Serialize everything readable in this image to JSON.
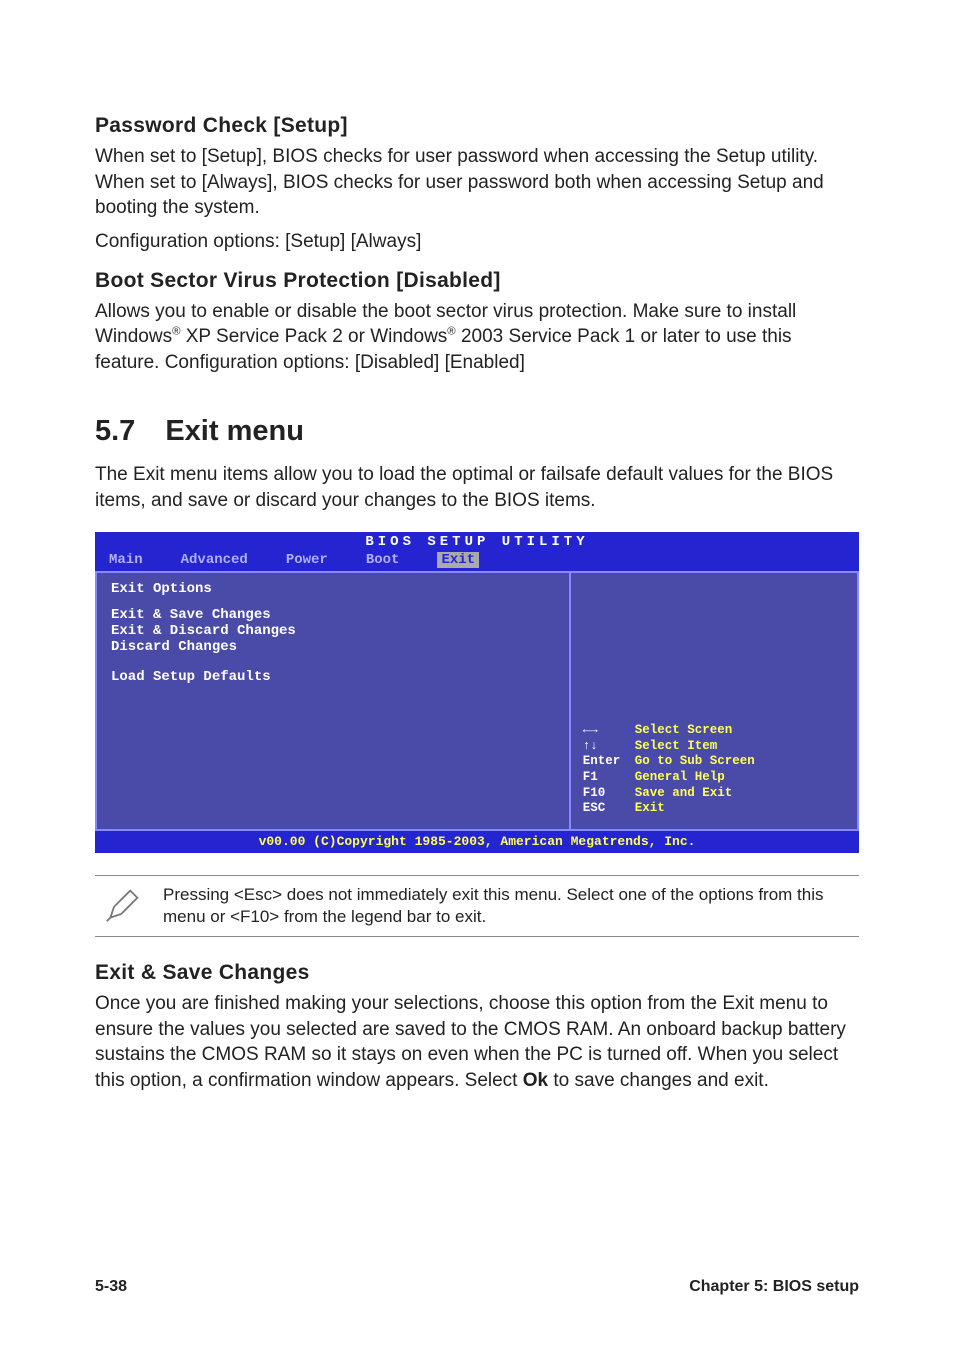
{
  "section1": {
    "heading": "Password Check [Setup]",
    "body": "When set to [Setup], BIOS checks for user password when accessing the Setup utility. When set to [Always], BIOS checks for user password both when accessing Setup and booting the system.",
    "opts": "Configuration options: [Setup] [Always]"
  },
  "section2": {
    "heading": "Boot Sector Virus Protection [Disabled]",
    "body_a": "Allows you to enable or disable the boot sector virus protection. Make sure to install Windows",
    "body_b": " XP Service Pack 2 or Windows",
    "body_c": " 2003 Service Pack 1 or later to use this feature. Configuration options: [Disabled] [Enabled]"
  },
  "main": {
    "num": "5.7",
    "title": "Exit menu",
    "intro": "The Exit menu items allow you to load the optimal or failsafe default values for the BIOS items, and save or discard your changes to the BIOS items."
  },
  "bios": {
    "title": "BIOS SETUP UTILITY",
    "tabs": [
      "Main",
      "Advanced",
      "Power",
      "Boot",
      "Exit"
    ],
    "active_tab": "Exit",
    "group": "Exit Options",
    "items": [
      "Exit & Save Changes",
      "Exit & Discard Changes",
      "Discard Changes"
    ],
    "item_last": "Load Setup Defaults",
    "help": [
      {
        "key": "←→",
        "txt": "Select Screen"
      },
      {
        "key": "↑↓",
        "txt": "Select Item"
      },
      {
        "key": "Enter",
        "txt": "Go to Sub Screen"
      },
      {
        "key": "F1",
        "txt": "General Help"
      },
      {
        "key": "F10",
        "txt": "Save and Exit"
      },
      {
        "key": "ESC",
        "txt": "Exit"
      }
    ],
    "copyright": "v00.00 (C)Copyright 1985-2003, American Megatrends, Inc."
  },
  "note": {
    "text": "Pressing <Esc> does not immediately exit this menu. Select one of the options from this menu or <F10> from the legend bar to exit."
  },
  "section3": {
    "heading": "Exit & Save Changes",
    "body_a": "Once you are finished making your selections, choose this option from the Exit menu to ensure the values you selected are saved to the CMOS RAM. An onboard backup battery sustains the CMOS RAM so it stays on even when the PC is turned off. When you select this option, a confirmation window appears. Select ",
    "ok": "Ok",
    "body_b": " to save changes and exit."
  },
  "footer": {
    "left": "5-38",
    "right": "Chapter 5: BIOS setup"
  }
}
